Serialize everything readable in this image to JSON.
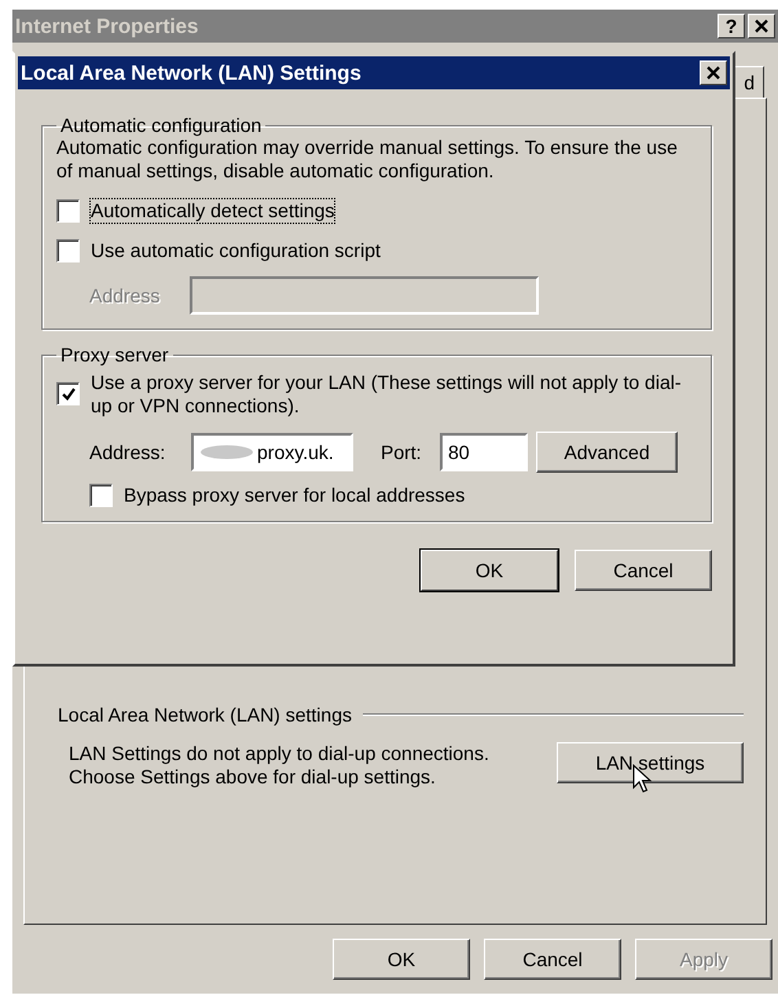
{
  "window": {
    "title": "Internet Properties",
    "help_button": "?",
    "tab_fragment": "d"
  },
  "lan_section": {
    "heading": "Local Area Network (LAN) settings",
    "description": [
      "LAN Settings do not apply to dial-up connections.",
      "Choose Settings above for dial-up settings."
    ],
    "button": "LAN settings"
  },
  "buttons": [
    {
      "label": "OK",
      "disabled": false
    },
    {
      "label": "Cancel",
      "disabled": false
    },
    {
      "label": "Apply",
      "disabled": true
    }
  ],
  "dialog": {
    "title": "Local Area Network (LAN) Settings",
    "automatic_configuration": {
      "heading": "Automatic configuration",
      "description": "Automatic configuration may override manual settings.  To ensure the use of manual settings, disable automatic configuration.",
      "options": [
        {
          "label": "Automatically detect settings",
          "checked": false,
          "focused": true
        },
        {
          "label": "Use automatic configuration script",
          "checked": false,
          "focused": false
        }
      ],
      "address": {
        "label": "Address",
        "disabled": true
      }
    },
    "proxy_server": {
      "heading": "Proxy server",
      "use_proxy": {
        "label": "Use a proxy server for your LAN (These settings will not apply to dial-up or VPN connections).",
        "checked": true
      },
      "address": {
        "label": "Address:",
        "value": "proxy.uk."
      },
      "port": {
        "label": "Port:",
        "value": "80"
      },
      "advanced_button": "Advanced",
      "bypass": {
        "label": "Bypass proxy server for local addresses",
        "checked": false
      }
    },
    "buttons": [
      {
        "label": "OK",
        "default": true
      },
      {
        "label": "Cancel",
        "default": false
      }
    ]
  }
}
